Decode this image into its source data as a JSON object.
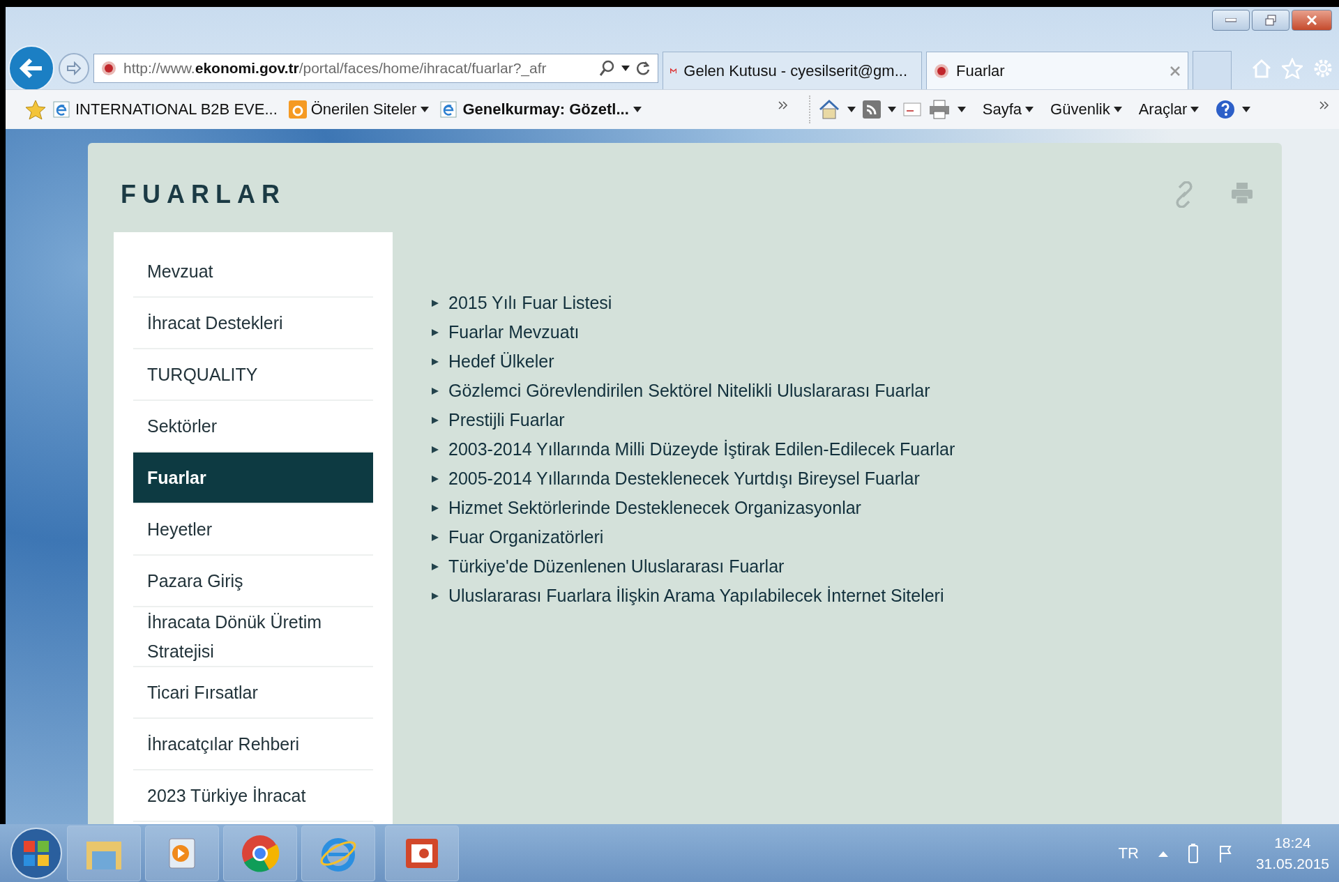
{
  "browser": {
    "address": "http://www.**ekonomi.gov.tr**/portal/faces/home/ihracat/fuarlar?_afr",
    "tabs": [
      {
        "title": "Gelen Kutusu - cyesilserit@gm...",
        "kind": "mail",
        "selected": false
      },
      {
        "title": "Fuarlar",
        "kind": "site",
        "selected": true
      }
    ],
    "favorites": [
      {
        "label": "INTERNATIONAL B2B EVE...",
        "kind": "page",
        "bold": false,
        "has_menu": false
      },
      {
        "label": "Önerilen Siteler",
        "kind": "suggested",
        "bold": false,
        "has_menu": true
      },
      {
        "label": "Genelkurmay: Gözetl...",
        "kind": "page",
        "bold": true,
        "has_menu": true
      }
    ],
    "commands": [
      "Sayfa",
      "Güvenlik",
      "Araçlar"
    ]
  },
  "page": {
    "title": "FUARLAR",
    "sidebar": [
      {
        "label": "Mevzuat",
        "selected": false
      },
      {
        "label": "İhracat Destekleri",
        "selected": false
      },
      {
        "label": "TURQUALITY",
        "selected": false
      },
      {
        "label": "Sektörler",
        "selected": false
      },
      {
        "label": "Fuarlar",
        "selected": true
      },
      {
        "label": "Heyetler",
        "selected": false
      },
      {
        "label": "Pazara Giriş",
        "selected": false
      },
      {
        "label": "İhracata Dönük Üretim Stratejisi",
        "selected": false
      },
      {
        "label": "Ticari Fırsatlar",
        "selected": false
      },
      {
        "label": "İhracatçılar Rehberi",
        "selected": false
      },
      {
        "label": "2023 Türkiye İhracat",
        "selected": false
      }
    ],
    "links": [
      "2015 Yılı Fuar Listesi",
      "Fuarlar Mevzuatı",
      "Hedef Ülkeler",
      "Gözlemci Görevlendirilen Sektörel Nitelikli Uluslararası Fuarlar",
      "Prestijli Fuarlar",
      "2003-2014 Yıllarında Milli Düzeyde İştirak Edilen-Edilecek Fuarlar",
      "2005-2014 Yıllarında Desteklenecek Yurtdışı Bireysel Fuarlar",
      "Hizmet Sektörlerinde Desteklenecek Organizasyonlar",
      "Fuar Organizatörleri",
      "Türkiye'de Düzenlenen Uluslararası Fuarlar",
      "Uluslararası Fuarlara İlişkin Arama Yapılabilecek İnternet Siteleri"
    ]
  },
  "taskbar": {
    "language": "TR",
    "time": "18:24",
    "date": "31.05.2015"
  }
}
